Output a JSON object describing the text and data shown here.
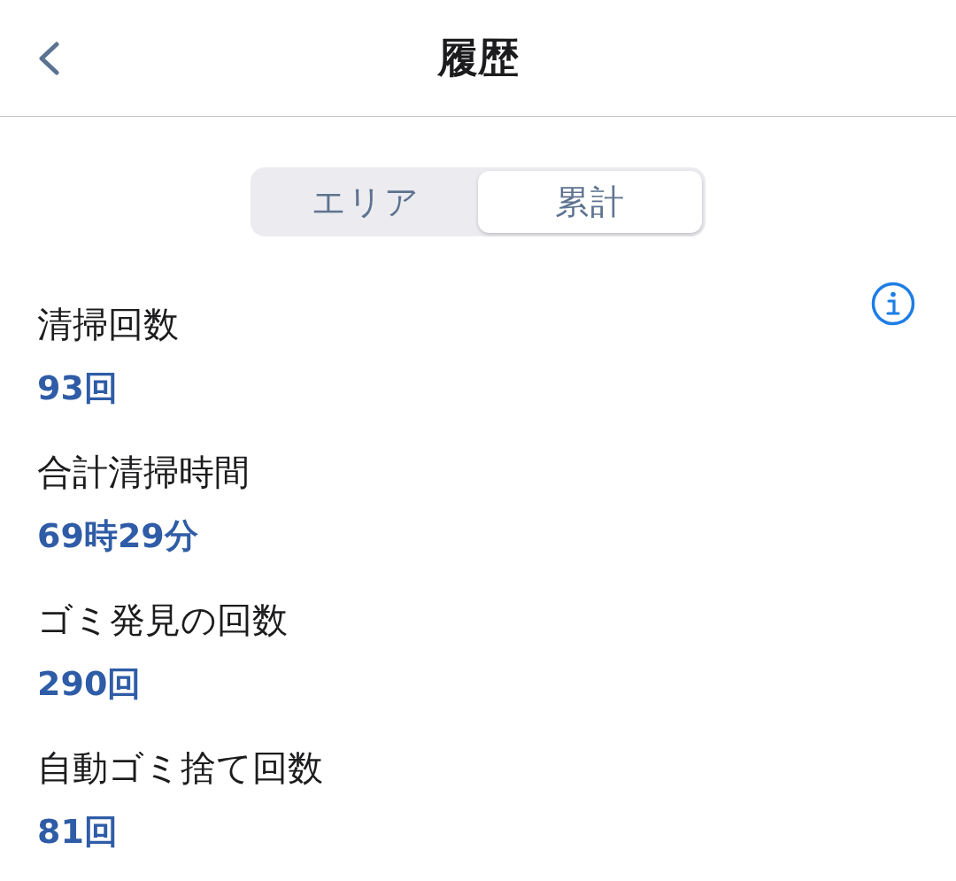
{
  "header": {
    "title": "履歴"
  },
  "segments": [
    {
      "label": "エリア",
      "selected": false
    },
    {
      "label": "累計",
      "selected": true
    }
  ],
  "stats": [
    {
      "label": "清掃回数",
      "value": "93回"
    },
    {
      "label": "合計清掃時間",
      "value": "69時29分"
    },
    {
      "label": "ゴミ発見の回数",
      "value": "290回"
    },
    {
      "label": "自動ゴミ捨て回数",
      "value": "81回"
    }
  ]
}
